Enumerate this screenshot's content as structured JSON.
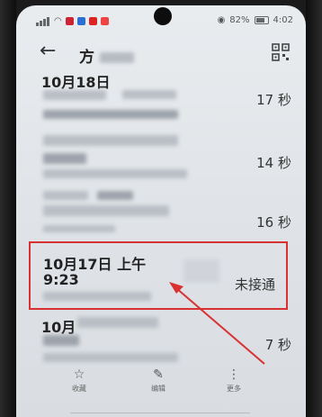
{
  "status_bar": {
    "battery": "82%",
    "time": "4:02"
  },
  "header": {
    "back_icon": "arrow-left-icon",
    "name_prefix": "方",
    "qr_icon": "qr-code-icon"
  },
  "calls": [
    {
      "date": "10月18日",
      "duration": "17 秒"
    },
    {
      "duration": "14 秒"
    },
    {
      "duration": "16 秒"
    },
    {
      "date_line1": "10月17日 上午",
      "date_line2": "9:23",
      "status": "未接通"
    },
    {
      "date": "10月",
      "duration": "7 秒"
    }
  ],
  "bottom_tabs": [
    {
      "label": "收藏",
      "icon": "star-icon"
    },
    {
      "label": "编辑",
      "icon": "pencil-icon"
    },
    {
      "label": "更多",
      "icon": "more-icon"
    }
  ],
  "annotation": {
    "color": "#d93131"
  }
}
